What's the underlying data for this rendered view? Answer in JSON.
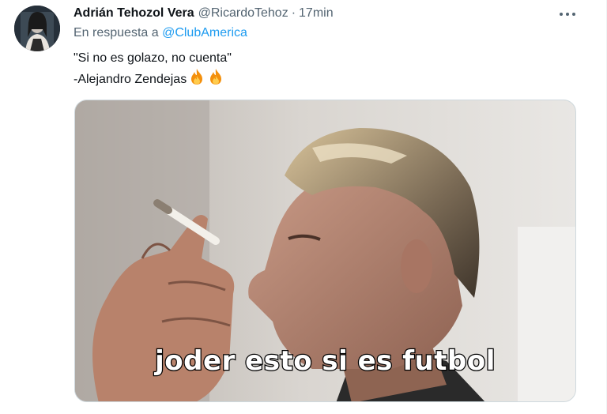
{
  "tweet": {
    "author": {
      "display_name": "Adrián Tehozol Vera",
      "handle": "@RicardoTehoz",
      "separator": "·",
      "time": "17min"
    },
    "reply_prefix": "En respuesta a",
    "reply_mention": "@ClubAmerica",
    "text_lines": [
      "\"Si no es golazo, no cuenta\"",
      "-Alejandro Zendejas"
    ],
    "emojis": [
      "fire-emoji",
      "fire-emoji"
    ],
    "media": {
      "caption": "joder esto si es futbol"
    }
  },
  "icons": {
    "more": "more-horizontal-icon",
    "fire": "fire-emoji"
  },
  "colors": {
    "text_primary": "#0f1419",
    "text_secondary": "#536471",
    "link": "#1d9bf0",
    "border": "#cfd9de"
  }
}
